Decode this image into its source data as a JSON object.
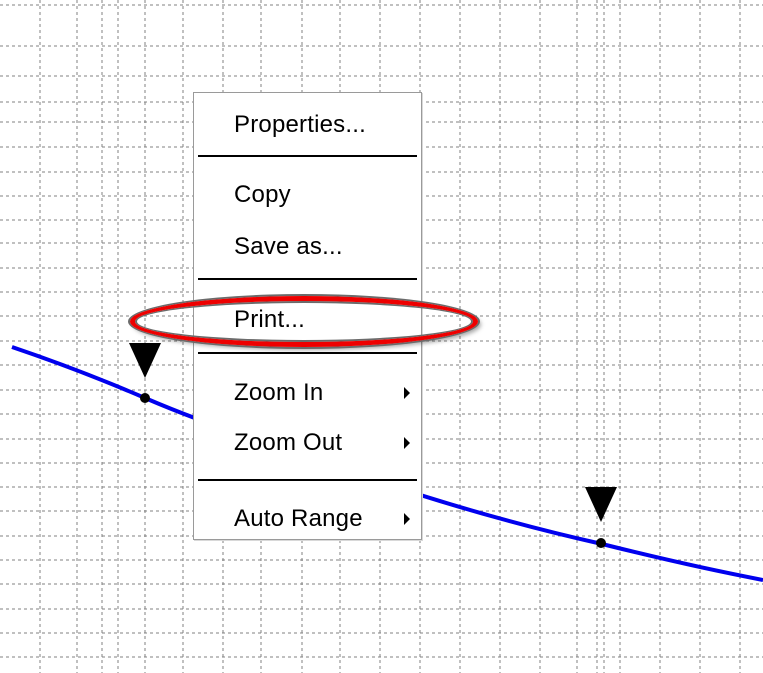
{
  "colors": {
    "background": "#ffffff",
    "grid": "#808080",
    "curve": "#0000ee",
    "marker": "#000000",
    "menu_border": "#9a9a9a",
    "highlight": "#ee0000"
  },
  "plot": {
    "grid_style": "dashed",
    "markers": [
      "triangle-down-icon",
      "triangle-down-icon"
    ]
  },
  "context_menu": {
    "items": [
      {
        "label": "Properties...",
        "submenu": false
      },
      {
        "label": "Copy",
        "submenu": false
      },
      {
        "label": "Save as...",
        "submenu": false
      },
      {
        "label": "Print...",
        "submenu": false,
        "highlighted": true
      },
      {
        "label": "Zoom In",
        "submenu": true
      },
      {
        "label": "Zoom Out",
        "submenu": true
      },
      {
        "label": "Auto Range",
        "submenu": true
      }
    ]
  }
}
